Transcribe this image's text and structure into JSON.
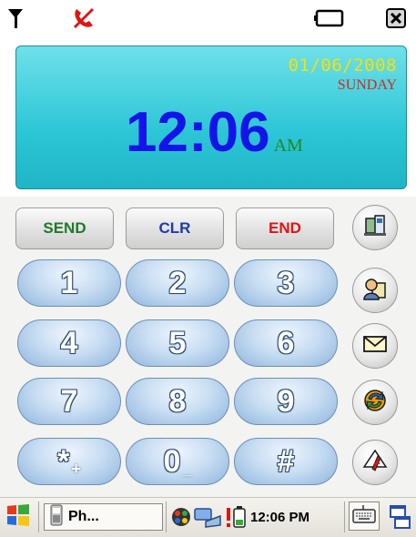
{
  "status_bar": {
    "icons": [
      "signal-antenna-icon",
      "phone-off-icon",
      "battery-icon",
      "close-icon"
    ]
  },
  "display": {
    "date": "01/06/2008",
    "day": "SUNDAY",
    "time": "12:06",
    "ampm": "AM"
  },
  "function_buttons": {
    "send": "SEND",
    "clear": "CLR",
    "end": "END"
  },
  "keys": [
    {
      "label": "1",
      "sub": ""
    },
    {
      "label": "2",
      "sub": ""
    },
    {
      "label": "3",
      "sub": ""
    },
    {
      "label": "4",
      "sub": ""
    },
    {
      "label": "5",
      "sub": ""
    },
    {
      "label": "6",
      "sub": ""
    },
    {
      "label": "7",
      "sub": ""
    },
    {
      "label": "8",
      "sub": ""
    },
    {
      "label": "9",
      "sub": ""
    },
    {
      "label": "*",
      "sub": "+"
    },
    {
      "label": "0",
      "sub": "_"
    },
    {
      "label": "#",
      "sub": ""
    }
  ],
  "side_buttons": [
    "call-history-icon",
    "contacts-icon",
    "message-icon",
    "refresh-icon",
    "note-pen-icon"
  ],
  "taskbar": {
    "app_label": "Ph...",
    "time": "12:06 PM",
    "icons": [
      "start-windows-icon",
      "phone-app-icon",
      "media-icon",
      "network-icon",
      "battery-alert-icon",
      "keyboard-icon",
      "window-switch-icon"
    ]
  },
  "colors": {
    "display_bg": "#2cc6d6",
    "date": "#f5e200",
    "day": "#d22a16",
    "time": "#1414e8",
    "ampm": "#1f8a1f",
    "send": "#1f7a2a",
    "clear": "#1f3aa8",
    "end": "#e01414"
  }
}
